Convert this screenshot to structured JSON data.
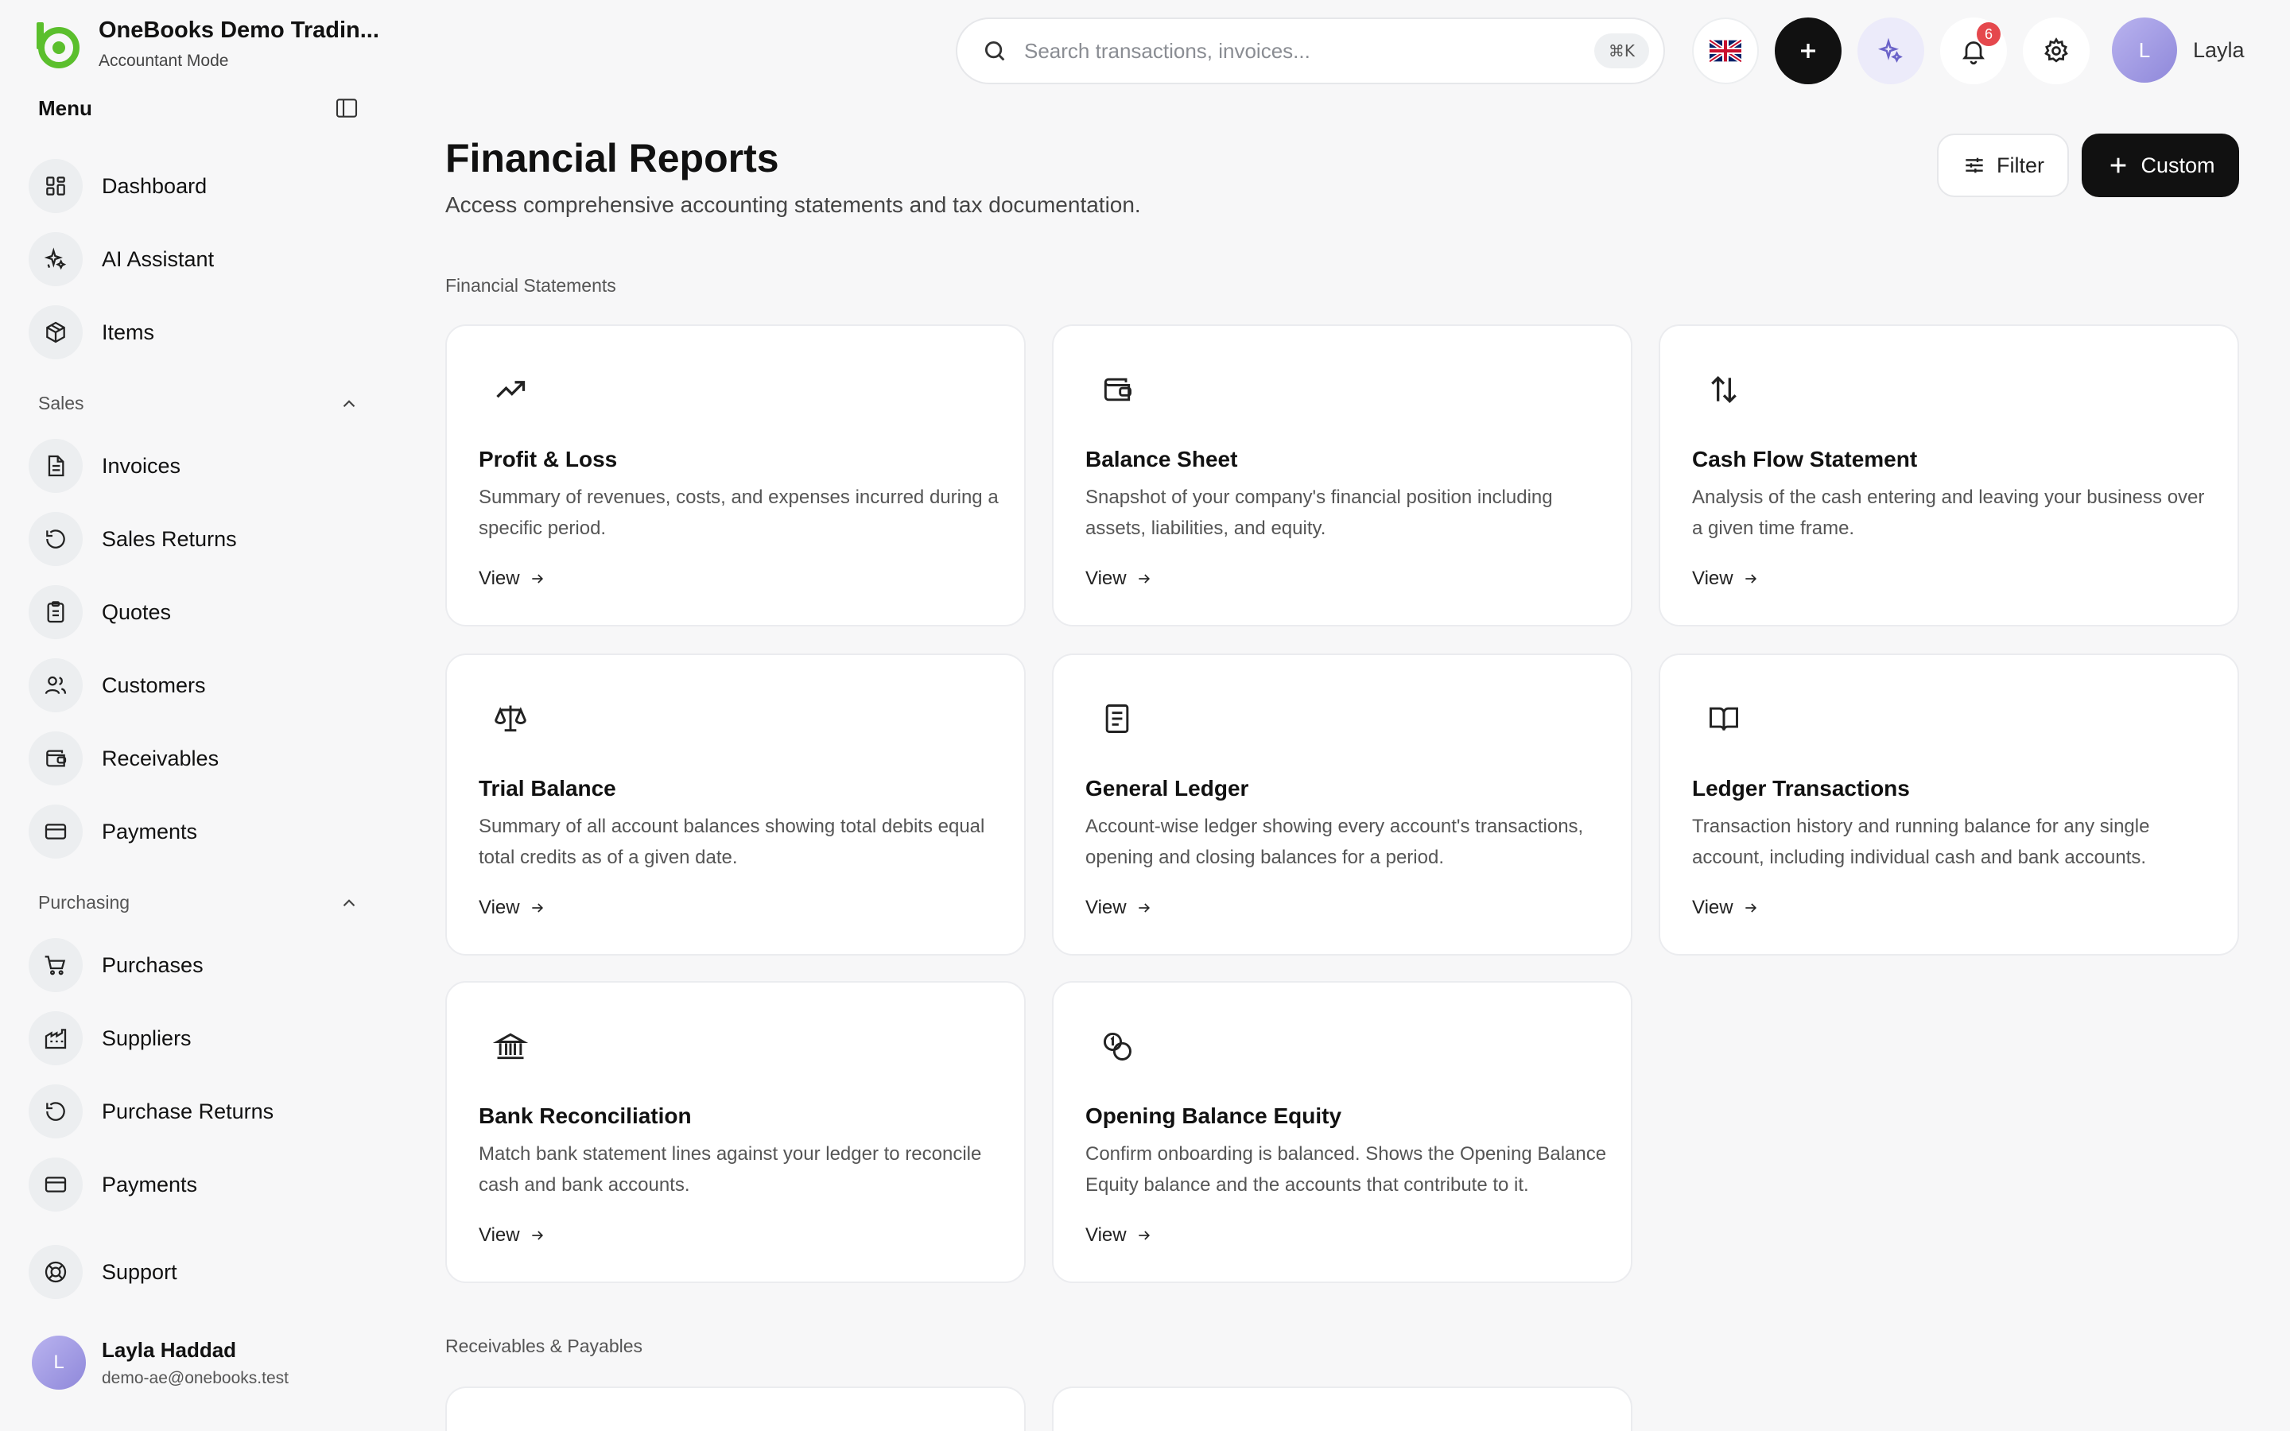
{
  "brand": {
    "title": "OneBooks Demo Tradin...",
    "subtitle": "Accountant Mode"
  },
  "sidebar": {
    "menu_label": "Menu",
    "top_items": [
      {
        "label": "Dashboard",
        "icon": "dashboard-icon"
      },
      {
        "label": "AI Assistant",
        "icon": "sparkles-icon"
      },
      {
        "label": "Items",
        "icon": "package-icon"
      }
    ],
    "sales": {
      "label": "Sales",
      "items": [
        {
          "label": "Invoices",
          "icon": "invoice-icon"
        },
        {
          "label": "Sales Returns",
          "icon": "rotate-icon"
        },
        {
          "label": "Quotes",
          "icon": "clipboard-icon"
        },
        {
          "label": "Customers",
          "icon": "users-icon"
        },
        {
          "label": "Receivables",
          "icon": "wallet-icon"
        },
        {
          "label": "Payments",
          "icon": "credit-card-icon"
        }
      ]
    },
    "purchasing": {
      "label": "Purchasing",
      "items": [
        {
          "label": "Purchases",
          "icon": "cart-icon"
        },
        {
          "label": "Suppliers",
          "icon": "factory-icon"
        },
        {
          "label": "Purchase Returns",
          "icon": "rotate-icon"
        },
        {
          "label": "Payments",
          "icon": "credit-card-icon"
        }
      ]
    },
    "support_label": "Support",
    "user": {
      "initial": "L",
      "name": "Layla Haddad",
      "email": "demo-ae@onebooks.test"
    }
  },
  "topbar": {
    "search_placeholder": "Search transactions, invoices...",
    "shortcut": "⌘K",
    "notification_count": "6",
    "user_initial": "L",
    "user_name": "Layla"
  },
  "page": {
    "title": "Financial Reports",
    "subtitle": "Access comprehensive accounting statements and tax documentation.",
    "filter_label": "Filter",
    "custom_label": "Custom"
  },
  "groups": {
    "financial_statements": "Financial Statements",
    "receivables_payables": "Receivables & Payables"
  },
  "cards": [
    {
      "title": "Profit & Loss",
      "desc": "Summary of revenues, costs, and expenses incurred during a specific period.",
      "link": "View",
      "icon": "trending-up-icon"
    },
    {
      "title": "Balance Sheet",
      "desc": "Snapshot of your company's financial position including assets, liabilities, and equity.",
      "link": "View",
      "icon": "wallet-icon"
    },
    {
      "title": "Cash Flow Statement",
      "desc": "Analysis of the cash entering and leaving your business over a given time frame.",
      "link": "View",
      "icon": "arrows-up-down-icon"
    },
    {
      "title": "Trial Balance",
      "desc": "Summary of all account balances showing total debits equal total credits as of a given date.",
      "link": "View",
      "icon": "scale-icon"
    },
    {
      "title": "General Ledger",
      "desc": "Account-wise ledger showing every account's transactions, opening and closing balances for a period.",
      "link": "View",
      "icon": "ledger-book-icon"
    },
    {
      "title": "Ledger Transactions",
      "desc": "Transaction history and running balance for any single account, including individual cash and bank accounts.",
      "link": "View",
      "icon": "open-book-icon"
    },
    {
      "title": "Bank Reconciliation",
      "desc": "Match bank statement lines against your ledger to reconcile cash and bank accounts.",
      "link": "View",
      "icon": "bank-icon"
    },
    {
      "title": "Opening Balance Equity",
      "desc": "Confirm onboarding is balanced. Shows the Opening Balance Equity balance and the accounts that contribute to it.",
      "link": "View",
      "icon": "coins-icon"
    }
  ],
  "colors": {
    "accent": "#111111",
    "brand_green": "#5bbf2d",
    "badge": "#e5484d",
    "avatar": "#a49ee6"
  }
}
